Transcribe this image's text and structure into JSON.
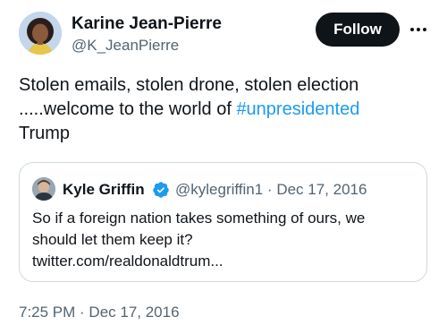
{
  "author": {
    "name": "Karine Jean-Pierre",
    "handle": "@K_JeanPierre",
    "avatar_icon": "user-avatar-photo"
  },
  "follow_label": "Follow",
  "more_icon": "more-horizontal-icon",
  "tweet": {
    "line1": "Stolen emails, stolen drone, stolen election",
    "line2_prefix": ".....welcome to the world of ",
    "hashtag": "#unpresidented",
    "line3": "Trump"
  },
  "quoted": {
    "name": "Kyle Griffin",
    "verified_icon": "verified-badge-icon",
    "meta": "@kylegriffin1 · Dec 17, 2016",
    "line1": "So if a foreign nation takes something of ours, we",
    "line2": "should let them keep it?",
    "line3": "twitter.com/realdonaldtrum..."
  },
  "timestamp": "7:25 PM · Dec 17, 2016",
  "colors": {
    "text": "#0f1419",
    "secondary": "#536471",
    "link": "#1d9bf0",
    "border": "#cfd9de",
    "verified": "#1d9bf0"
  }
}
